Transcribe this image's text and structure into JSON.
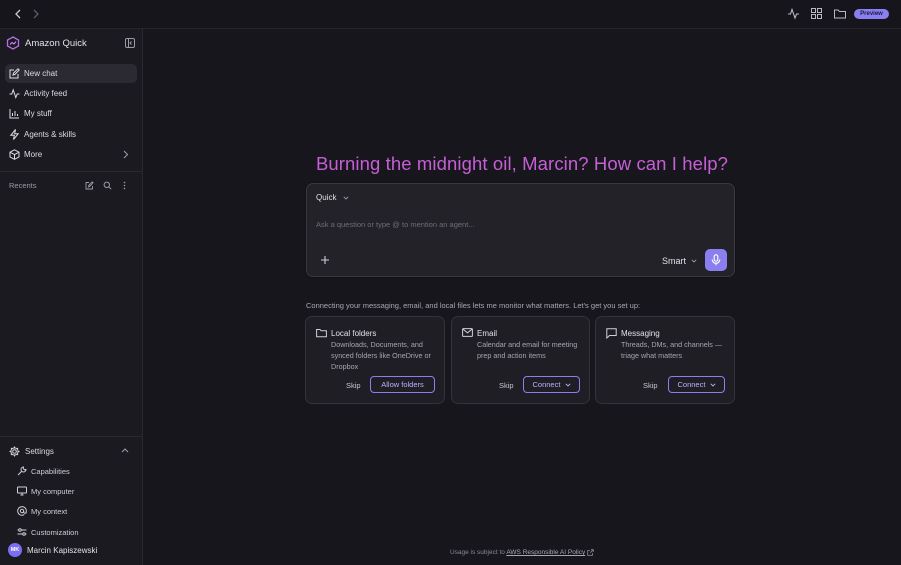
{
  "topbar": {
    "badge": "Preview",
    "icons": [
      "chevron-left-icon",
      "chevron-right-icon",
      "activity-icon",
      "grid-icon",
      "folder-icon"
    ]
  },
  "sidebar": {
    "brand": "Amazon Quick",
    "nav": [
      {
        "label": "New chat",
        "icon": "new-chat-icon",
        "active": true
      },
      {
        "label": "Activity feed",
        "icon": "activity-icon"
      },
      {
        "label": "My stuff",
        "icon": "chart-icon"
      },
      {
        "label": "Agents & skills",
        "icon": "lightning-icon"
      },
      {
        "label": "More",
        "icon": "cube-icon"
      }
    ],
    "recents_label": "Recents",
    "settings": {
      "label": "Settings",
      "items": [
        {
          "label": "Capabilities",
          "icon": "wrench-icon"
        },
        {
          "label": "My computer",
          "icon": "monitor-icon"
        },
        {
          "label": "My context",
          "icon": "at-icon"
        },
        {
          "label": "Customization",
          "icon": "sliders-icon"
        }
      ]
    },
    "user": {
      "initials": "MK",
      "name": "Marcin Kapiszewski"
    }
  },
  "main": {
    "greeting": "Burning the midnight oil, Marcin? How can I help?",
    "composer": {
      "agent": "Quick",
      "placeholder": "Ask a question or type @ to mention an agent...",
      "mode": "Smart"
    },
    "connect_text": "Connecting your messaging, email, and local files lets me monitor what matters. Let's get you set up:",
    "cards": [
      {
        "title": "Local folders",
        "desc": "Downloads, Documents, and synced folders like OneDrive or Dropbox",
        "skip": "Skip",
        "action": "Allow folders"
      },
      {
        "title": "Email",
        "desc": "Calendar and email for meeting prep and action items",
        "skip": "Skip",
        "action": "Connect"
      },
      {
        "title": "Messaging",
        "desc": "Threads, DMs, and channels — triage what matters",
        "skip": "Skip",
        "action": "Connect"
      }
    ],
    "footer_prefix": "Usage is subject to",
    "footer_link": "AWS Responsible AI Policy"
  },
  "colors": {
    "accent": "#8b7ff0",
    "greeting": "#c65fd6",
    "background": "#17161c"
  }
}
